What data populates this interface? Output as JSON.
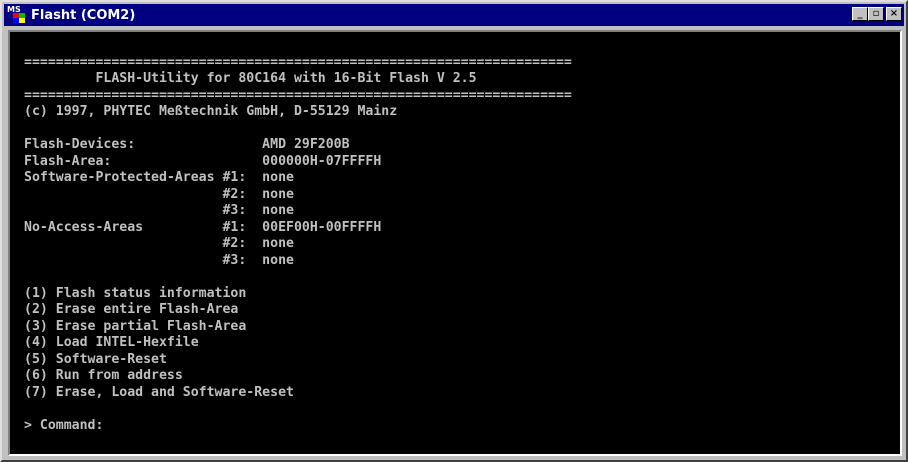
{
  "window": {
    "title": "Flasht (COM2)",
    "minimize_glyph": "_",
    "maximize_glyph": "▫",
    "close_glyph": "×"
  },
  "console": {
    "lines": [
      "",
      "=====================================================================",
      "         FLASH-Utility for 80C164 with 16-Bit Flash V 2.5",
      "=====================================================================",
      "(c) 1997, PHYTEC Meßtechnik GmbH, D-55129 Mainz",
      "",
      "Flash-Devices:                AMD 29F200B",
      "Flash-Area:                   000000H-07FFFFH",
      "Software-Protected-Areas #1:  none",
      "                         #2:  none",
      "                         #3:  none",
      "No-Access-Areas          #1:  00EF00H-00FFFFH",
      "                         #2:  none",
      "                         #3:  none",
      "",
      "(1) Flash status information",
      "(2) Erase entire Flash-Area",
      "(3) Erase partial Flash-Area",
      "(4) Load INTEL-Hexfile",
      "(5) Software-Reset",
      "(6) Run from address",
      "(7) Erase, Load and Software-Reset",
      "",
      "> Command:"
    ]
  },
  "colors": {
    "titlebar": "#000080",
    "console_bg": "#000000",
    "console_fg": "#c0c0c0"
  },
  "icons": {
    "app": "ms-dos-icon",
    "minimize": "minimize-icon",
    "maximize": "maximize-icon",
    "close": "close-icon"
  }
}
